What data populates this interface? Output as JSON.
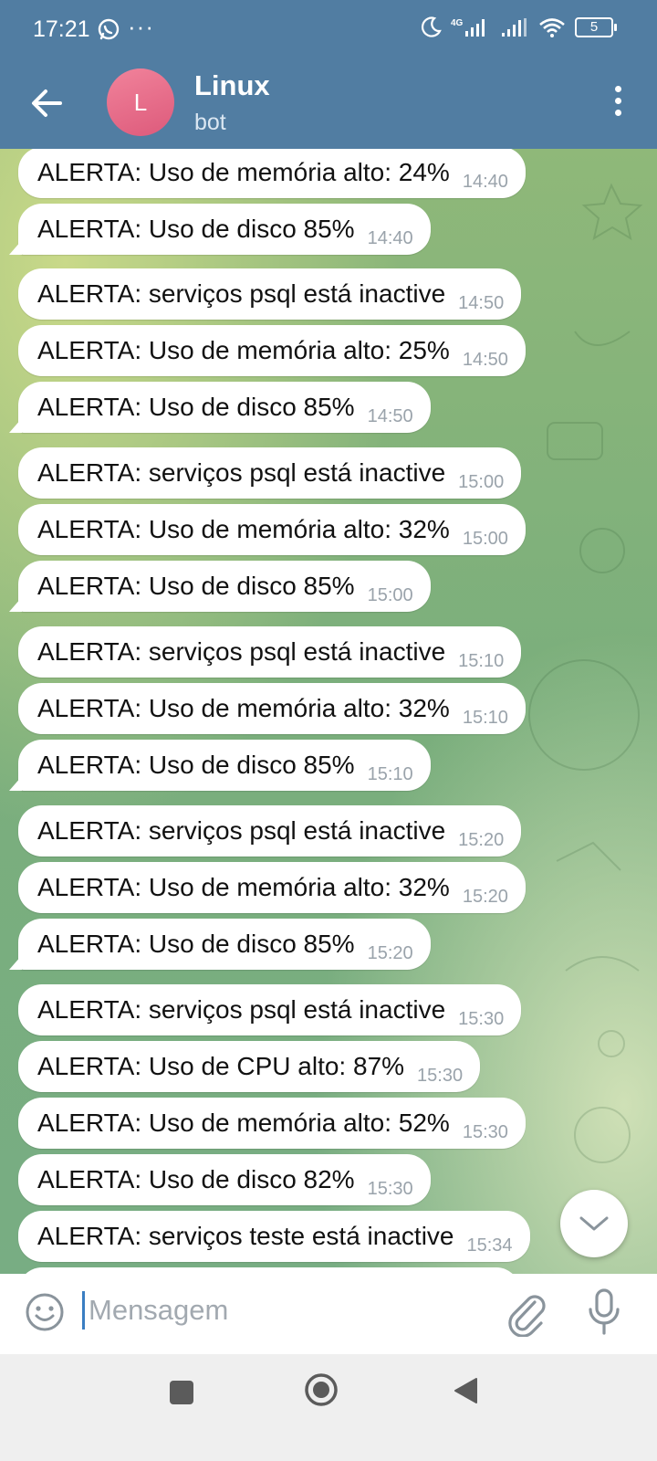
{
  "status_bar": {
    "time": "17:21",
    "dots": "···",
    "network": "4G",
    "battery": "5"
  },
  "header": {
    "avatar_letter": "L",
    "title": "Linux",
    "subtitle": "bot"
  },
  "messages": [
    {
      "text": "ALERTA: Uso de memória alto: 24%",
      "time": "14:40"
    },
    {
      "text": "ALERTA: Uso de disco 85%",
      "time": "14:40"
    },
    {
      "text": "ALERTA: serviços psql está inactive",
      "time": "14:50"
    },
    {
      "text": "ALERTA: Uso de memória alto: 25%",
      "time": "14:50"
    },
    {
      "text": "ALERTA: Uso de disco 85%",
      "time": "14:50"
    },
    {
      "text": "ALERTA: serviços psql está inactive",
      "time": "15:00"
    },
    {
      "text": "ALERTA: Uso de memória alto: 32%",
      "time": "15:00"
    },
    {
      "text": "ALERTA: Uso de disco 85%",
      "time": "15:00"
    },
    {
      "text": "ALERTA: serviços psql está inactive",
      "time": "15:10"
    },
    {
      "text": "ALERTA: Uso de memória alto: 32%",
      "time": "15:10"
    },
    {
      "text": "ALERTA: Uso de disco 85%",
      "time": "15:10"
    },
    {
      "text": "ALERTA: serviços psql está inactive",
      "time": "15:20"
    },
    {
      "text": "ALERTA: Uso de memória alto: 32%",
      "time": "15:20"
    },
    {
      "text": "ALERTA: Uso de disco 85%",
      "time": "15:20"
    },
    {
      "text": "ALERTA: serviços psql está inactive",
      "time": "15:30"
    },
    {
      "text": "ALERTA: Uso de CPU alto: 87%",
      "time": "15:30"
    },
    {
      "text": "ALERTA: Uso de memória alto: 52%",
      "time": "15:30"
    },
    {
      "text": "ALERTA: Uso de disco 82%",
      "time": "15:30"
    },
    {
      "text": "ALERTA: serviços teste está inactive",
      "time": "15:34"
    }
  ],
  "composer": {
    "placeholder": "Mensagem"
  },
  "colors": {
    "header": "#517da2",
    "bubble": "#ffffff",
    "time": "#9aa3ab",
    "cursor": "#3a7ec2"
  },
  "icons": [
    "back-arrow-icon",
    "more-vertical-icon",
    "chevron-down-icon",
    "emoji-icon",
    "attach-icon",
    "mic-icon",
    "nav-square-icon",
    "nav-home-icon",
    "nav-back-icon"
  ]
}
